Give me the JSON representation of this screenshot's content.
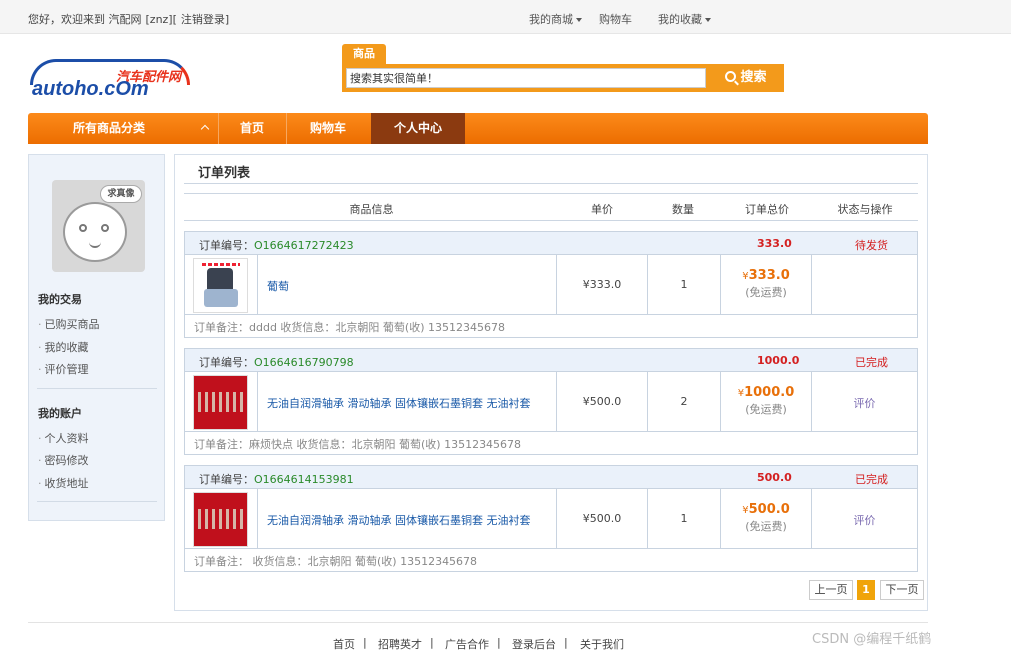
{
  "topbar": {
    "welcome": "您好，欢迎来到 汽配网",
    "user": "[znz][",
    "logout": "注销登录",
    "close": "]",
    "links": [
      "我的商城",
      "购物车",
      "我的收藏"
    ]
  },
  "logo": {
    "cn": "汽车配件网",
    "en": "autoho.cOm"
  },
  "search": {
    "tab": "商品",
    "value": "搜索其实很简单！",
    "button": "搜索"
  },
  "nav": {
    "all": "所有商品分类",
    "home": "首页",
    "cart": "购物车",
    "center": "个人中心"
  },
  "sidebar": {
    "avatar_text": "求真像",
    "sec1_title": "我的交易",
    "sec1_items": [
      "已购买商品",
      "我的收藏",
      "评价管理"
    ],
    "sec2_title": "我的账户",
    "sec2_items": [
      "个人资料",
      "密码修改",
      "收货地址"
    ]
  },
  "main": {
    "title": "订单列表",
    "headers": [
      "商品信息",
      "单价",
      "数量",
      "订单总价",
      "状态与操作"
    ]
  },
  "orders": [
    {
      "label": "订单编号：",
      "number": "O1664617272423",
      "total": "333.0",
      "status": "待发货",
      "name": "葡萄",
      "price": "¥333.0",
      "qty": "1",
      "yen": "¥",
      "total_big": "333.0",
      "ship": "(免运费)",
      "op": "",
      "note": "订单备注：dddd  收货信息：北京朝阳 葡萄(收) 13512345678"
    },
    {
      "label": "订单编号：",
      "number": "O1664616790798",
      "total": "1000.0",
      "status": "已完成",
      "name": "无油自润滑轴承 滑动轴承 固体镶嵌石墨铜套 无油衬套",
      "price": "¥500.0",
      "qty": "2",
      "yen": "¥",
      "total_big": "1000.0",
      "ship": "(免运费)",
      "op": "评价",
      "note": "订单备注：麻烦快点  收货信息：北京朝阳 葡萄(收) 13512345678"
    },
    {
      "label": "订单编号：",
      "number": "O1664614153981",
      "total": "500.0",
      "status": "已完成",
      "name": "无油自润滑轴承 滑动轴承 固体镶嵌石墨铜套 无油衬套",
      "price": "¥500.0",
      "qty": "1",
      "yen": "¥",
      "total_big": "500.0",
      "ship": "(免运费)",
      "op": "评价",
      "note": "订单备注：  收货信息：北京朝阳 葡萄(收) 13512345678"
    }
  ],
  "pager": {
    "prev": "上一页",
    "current": "1",
    "next": "下一页"
  },
  "footer": {
    "links": [
      "首页",
      "招聘英才",
      "广告合作",
      "登录后台",
      "关于我们"
    ],
    "sep": "|"
  },
  "watermark": "CSDN @编程千纸鹤"
}
